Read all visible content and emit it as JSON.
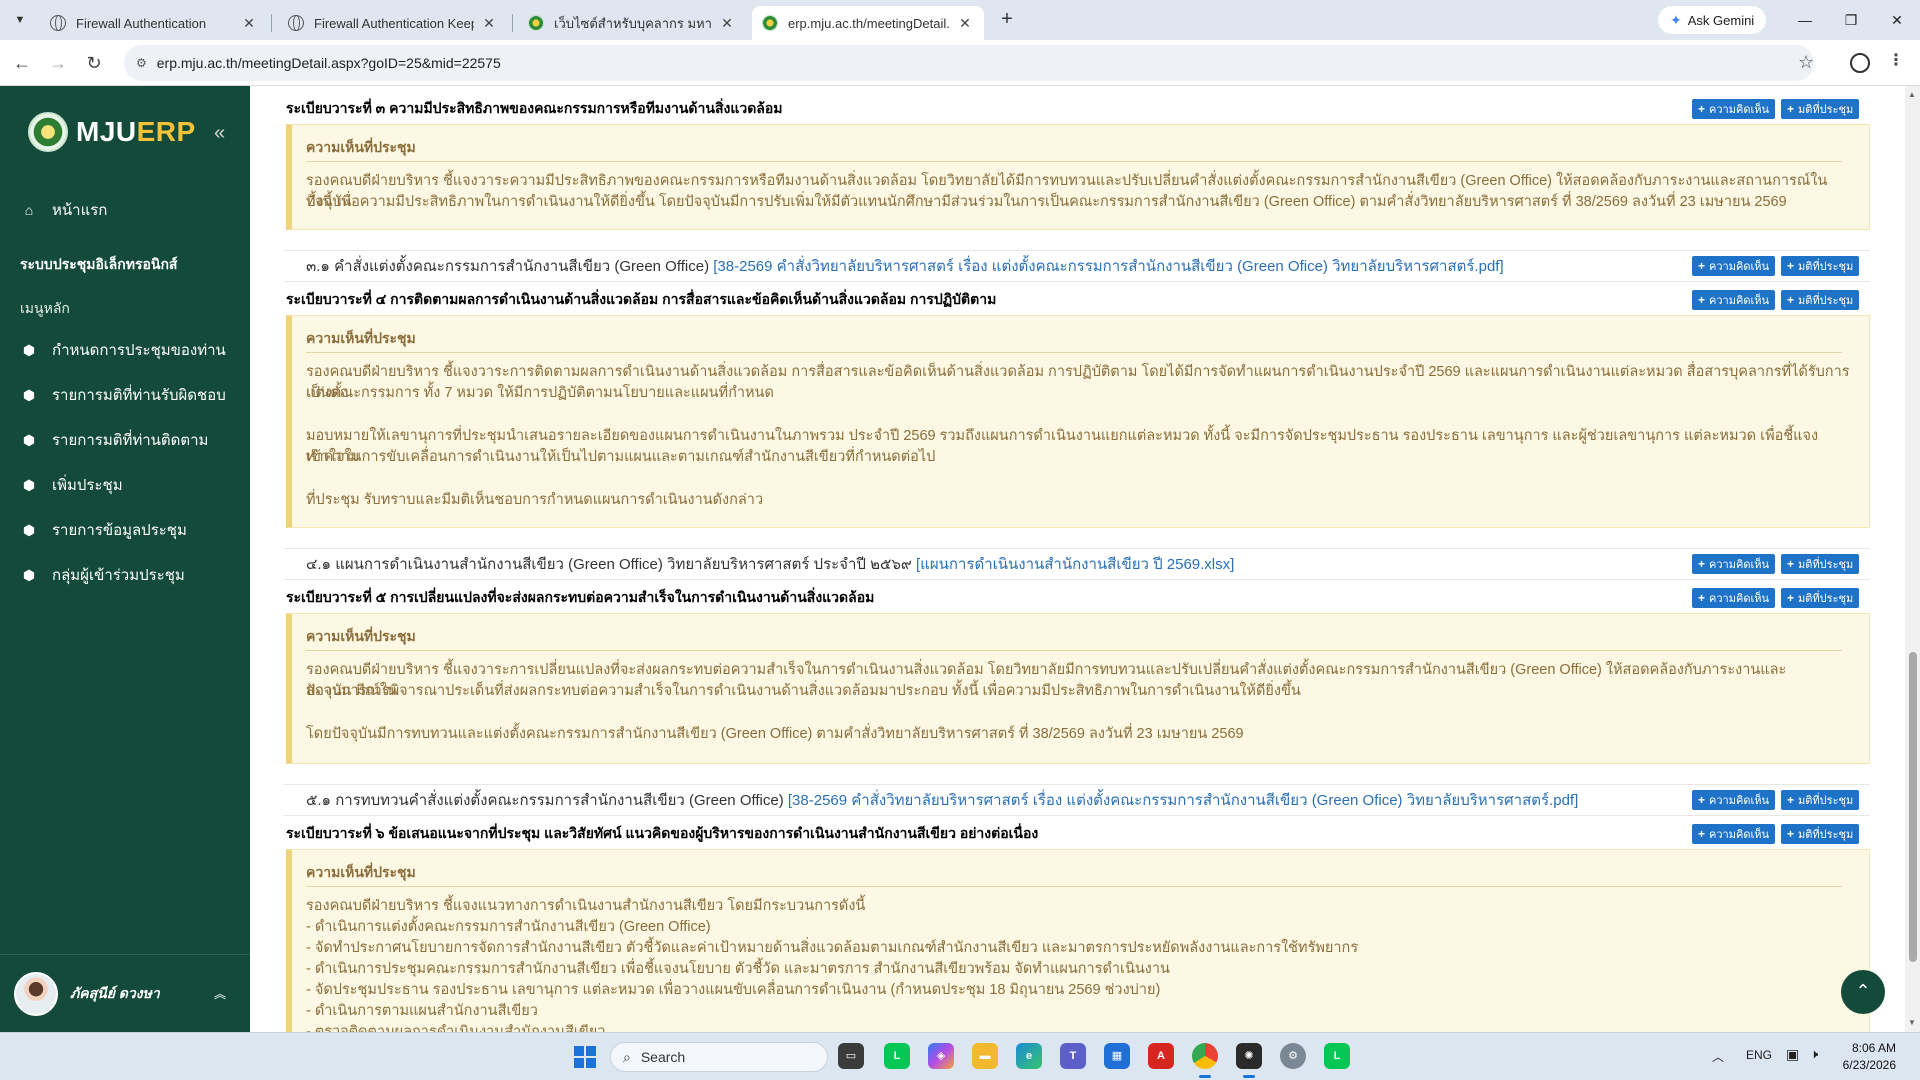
{
  "browser": {
    "tabs": [
      {
        "title": "Firewall Authentication"
      },
      {
        "title": "Firewall Authentication Keepalive"
      },
      {
        "title": "เว็บไซต์สำหรับบุคลากร มหาวิทยาลัยแม่โจ้"
      },
      {
        "title": "erp.mju.ac.th/meetingDetail.aspx"
      }
    ],
    "new_tab": "+",
    "ask_gemini": "Ask Gemini",
    "url": "erp.mju.ac.th/meetingDetail.aspx?goID=25&mid=22575"
  },
  "sidebar": {
    "logo_mju": "MJU",
    "logo_erp": "ERP",
    "collapse_icon": "«",
    "home": "หน้าแรก",
    "system_title": "ระบบประชุมอิเล็กทรอนิกส์",
    "menu_heading": "เมนูหลัก",
    "items": [
      {
        "label": "กำหนดการประชุมของท่าน"
      },
      {
        "label": "รายการมติที่ท่านรับผิดชอบ"
      },
      {
        "label": "รายการมติที่ท่านติดตาม"
      },
      {
        "label": "เพิ่มประชุม"
      },
      {
        "label": "รายการข้อมูลประชุม"
      },
      {
        "label": "กลุ่มผู้เข้าร่วมประชุม"
      }
    ],
    "user_name": "ภัคสุนีย์ ดวงษา"
  },
  "buttons": {
    "comment": "ความคิดเห็น",
    "resolution": "มติที่ประชุม"
  },
  "note_heading": "ความเห็นที่ประชุม",
  "agenda": {
    "a3": {
      "title": "ระเบียบวาระที่ ๓ ความมีประสิทธิภาพของคณะกรรมการหรือทีมงานด้านสิ่งแวดล้อม",
      "note": [
        "รองคณบดีฝ่ายบริหาร ชี้แจงวาระความมีประสิทธิภาพของคณะกรรมการหรือทีมงานด้านสิ่งแวดล้อม โดยวิทยาลัยได้มีการทบทวนและปรับเปลี่ยนคำสั่งแต่งตั้งคณะกรรมการสำนักงานสีเขียว (Green Office) ให้สอดคล้องกับภาระงานและสถานการณ์ในปัจจุบัน",
        "ทั้งนี้ เพื่อความมีประสิทธิภาพในการดำเนินงานให้ดียิ่งขึ้น โดยปัจจุบันมีการปรับเพิ่มให้มีตัวแทนนักศึกษามีส่วนร่วมในการเป็นคณะกรรมการสำนักงานสีเขียว (Green Office) ตามคำสั่งวิทยาลัยบริหารศาสตร์ ที่ 38/2569 ลงวันที่ 23 เมษายน 2569"
      ],
      "doc_text": "๓.๑ คำสั่งแต่งตั้งคณะกรรมการสำนักงานสีเขียว (Green Office)",
      "doc_link": "[38-2569 คำสั่งวิทยาลัยบริหารศาสตร์ เรื่อง แต่งตั้งคณะกรรมการสำนักงานสีเขียว (Green Ofice) วิทยาลัยบริหารศาสตร์.pdf]"
    },
    "a4": {
      "title": "ระเบียบวาระที่ ๔ การติดตามผลการดำเนินงานด้านสิ่งแวดล้อม การสื่อสารและข้อคิดเห็นด้านสิ่งแวดล้อม การปฏิบัติตาม",
      "note": [
        "รองคณบดีฝ่ายบริหาร ชี้แจงวาระการติดตามผลการดำเนินงานด้านสิ่งแวดล้อม การสื่อสารและข้อคิดเห็นด้านสิ่งแวดล้อม การปฏิบัติตาม โดยได้มีการจัดทำแผนการดำเนินงานประจำปี 2569 และแผนการดำเนินงานแต่ละหมวด สื่อสารบุคลากรที่ได้รับการแต่งตั้ง",
        "เป็นคณะกรรมการ ทั้ง 7 หมวด ให้มีการปฏิบัติตามนโยบายและแผนที่กำหนด",
        "มอบหมายให้เลขานุการที่ประชุมนำเสนอรายละเอียดของแผนการดำเนินงานในภาพรวม ประจำปี 2569 รวมถึงแผนการดำเนินงานแยกแต่ละหมวด ทั้งนี้ จะมีการจัดประชุมประธาน รองประธาน เลขานุการ และผู้ช่วยเลขานุการ แต่ละหมวด เพื่อชี้แจงทำความ",
        "เข้าใจในการขับเคลื่อนการดำเนินงานให้เป็นไปตามแผนและตามเกณฑ์สำนักงานสีเขียวที่กำหนดต่อไป",
        "ที่ประชุม รับทราบและมีมติเห็นชอบการกำหนดแผนการดำเนินงานดังกล่าว"
      ],
      "doc_text": "๔.๑ แผนการดำเนินงานสำนักงานสีเขียว (Green Office) วิทยาลัยบริหารศาสตร์ ประจำปี ๒๕๖๙",
      "doc_link": "[แผนการดำเนินงานสำนักงานสีเขียว ปี 2569.xlsx]"
    },
    "a5": {
      "title": "ระเบียบวาระที่ ๕ การเปลี่ยนแปลงที่จะส่งผลกระทบต่อความสำเร็จในการดำเนินงานด้านสิ่งแวดล้อม",
      "note": [
        "รองคณบดีฝ่ายบริหาร ชี้แจงวาระการเปลี่ยนแปลงที่จะส่งผลกระทบต่อความสำเร็จในการดำเนินงานสิ่งแวดล้อม โดยวิทยาลัยมีการทบทวนและปรับเปลี่ยนคำสั่งแต่งตั้งคณะกรรมการสำนักงานสีเขียว (Green Office) ให้สอดคล้องกับภาระงานและสถานการณ์ใน",
        "ปัจจุบัน มีการพิจารณาประเด็นที่ส่งผลกระทบต่อความสำเร็จในการดำเนินงานด้านสิ่งแวดล้อมมาประกอบ ทั้งนี้ เพื่อความมีประสิทธิภาพในการดำเนินงานให้ดียิ่งขึ้น",
        "โดยปัจจุบันมีการทบทวนและแต่งตั้งคณะกรรมการสำนักงานสีเขียว (Green Office) ตามคำสั่งวิทยาลัยบริหารศาสตร์ ที่ 38/2569 ลงวันที่ 23 เมษายน 2569"
      ],
      "doc_text": "๕.๑ การทบทวนคำสั่งแต่งตั้งคณะกรรมการสำนักงานสีเขียว (Green Office)",
      "doc_link": "[38-2569 คำสั่งวิทยาลัยบริหารศาสตร์ เรื่อง แต่งตั้งคณะกรรมการสำนักงานสีเขียว (Green Ofice) วิทยาลัยบริหารศาสตร์.pdf]"
    },
    "a6": {
      "title": "ระเบียบวาระที่ ๖ ข้อเสนอแนะจากที่ประชุม และวิสัยทัศน์ แนวคิดของผู้บริหารของการดำเนินงานสำนักงานสีเขียว อย่างต่อเนื่อง",
      "note": [
        "รองคณบดีฝ่ายบริหาร ชี้แจงแนวทางการดำเนินงานสำนักงานสีเขียว โดยมีกระบวนการดังนี้",
        "- ดำเนินการแต่งตั้งคณะกรรมการสำนักงานสีเขียว (Green Office)",
        "- จัดทำประกาศนโยบายการจัดการสำนักงานสีเขียว ตัวชี้วัดและค่าเป้าหมายด้านสิ่งแวดล้อมตามเกณฑ์สำนักงานสีเขียว และมาตรการประหยัดพลังงานและการใช้ทรัพยากร",
        "- ดำเนินการประชุมคณะกรรมการสำนักงานสีเขียว เพื่อชี้แจงนโยบาย ตัวชี้วัด และมาตรการ สำนักงานสีเขียวพร้อม จัดทำแผนการดำเนินงาน",
        "- จัดประชุมประธาน รองประธาน เลขานุการ แต่ละหมวด เพื่อวางแผนขับเคลื่อนการดำเนินงาน (กำหนดประชุม 18 มิถุนายน 2569 ช่วงบ่าย)",
        "- ดำเนินการตามแผนสำนักงานสีเขียว",
        "- ตรวจติดตามผลการดำเนินงานสำนักงานสีเขียว"
      ]
    }
  },
  "taskbar": {
    "search_placeholder": "Search",
    "lang": "ENG",
    "time": "8:06 AM",
    "date": "6/23/2026"
  }
}
